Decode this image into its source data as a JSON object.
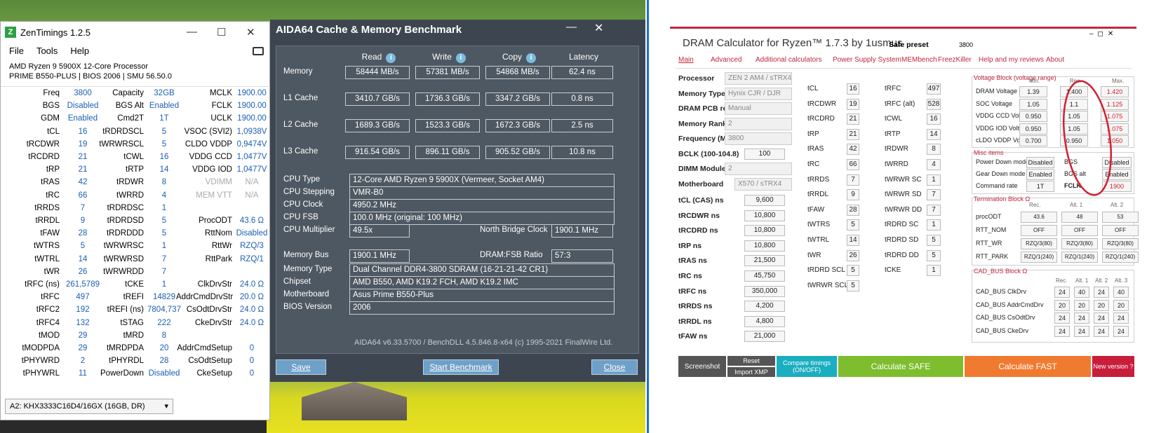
{
  "zentimings": {
    "title": "ZenTimings 1.2.5",
    "menu": [
      "File",
      "Tools",
      "Help"
    ],
    "cpu": "AMD Ryzen 9 5900X 12-Core Processor",
    "board": "PRIME B550-PLUS | BIOS 2006 | SMU 56.50.0",
    "rows": [
      [
        "Freq",
        "3800",
        "Capacity",
        "32GB",
        "MCLK",
        "1900.00"
      ],
      [
        "BGS",
        "Disabled",
        "BGS Alt",
        "Enabled",
        "FCLK",
        "1900.00"
      ],
      [
        "GDM",
        "Enabled",
        "Cmd2T",
        "1T",
        "UCLK",
        "1900.00"
      ],
      [
        "tCL",
        "16",
        "tRDRDSCL",
        "5",
        "VSOC (SVI2)",
        "1,0938V"
      ],
      [
        "tRCDWR",
        "19",
        "tWRWRSCL",
        "5",
        "CLDO VDDP",
        "0,9474V"
      ],
      [
        "tRCDRD",
        "21",
        "tCWL",
        "16",
        "VDDG CCD",
        "1,0477V"
      ],
      [
        "tRP",
        "21",
        "tRTP",
        "14",
        "VDDG IOD",
        "1,0477V"
      ],
      [
        "tRAS",
        "42",
        "tRDWR",
        "8",
        "VDIMM",
        "N/A"
      ],
      [
        "tRC",
        "66",
        "tWRRD",
        "4",
        "MEM VTT",
        "N/A"
      ],
      [
        "tRRDS",
        "7",
        "tRDRDSC",
        "1",
        "",
        ""
      ],
      [
        "tRRDL",
        "9",
        "tRDRDSD",
        "5",
        "ProcODT",
        "43.6 Ω"
      ],
      [
        "tFAW",
        "28",
        "tRDRDDD",
        "5",
        "RttNom",
        "Disabled"
      ],
      [
        "tWTRS",
        "5",
        "tWRWRSC",
        "1",
        "RttWr",
        "RZQ/3"
      ],
      [
        "tWTRL",
        "14",
        "tWRWRSD",
        "7",
        "RttPark",
        "RZQ/1"
      ],
      [
        "tWR",
        "26",
        "tWRWRDD",
        "7",
        "",
        ""
      ],
      [
        "tRFC (ns)",
        "261,5789",
        "tCKE",
        "1",
        "ClkDrvStr",
        "24.0 Ω"
      ],
      [
        "tRFC",
        "497",
        "tREFI",
        "14829",
        "AddrCmdDrvStr",
        "20.0 Ω"
      ],
      [
        "tRFC2",
        "192",
        "tREFI (ns)",
        "7804,737",
        "CsOdtDrvStr",
        "24.0 Ω"
      ],
      [
        "tRFC4",
        "132",
        "tSTAG",
        "222",
        "CkeDrvStr",
        "24.0 Ω"
      ],
      [
        "tMOD",
        "29",
        "tMRD",
        "8",
        "",
        ""
      ],
      [
        "tMODPDA",
        "29",
        "tMRDPDA",
        "20",
        "AddrCmdSetup",
        "0"
      ],
      [
        "tPHYWRD",
        "2",
        "tPHYRDL",
        "28",
        "CsOdtSetup",
        "0"
      ],
      [
        "tPHYWRL",
        "11",
        "PowerDown",
        "Disabled",
        "CkeSetup",
        "0"
      ]
    ],
    "dimm": "A2: KHX3333C16D4/16GX (16GB, DR)"
  },
  "aida": {
    "title": "AIDA64 Cache & Memory Benchmark",
    "headers": [
      "Read",
      "Write",
      "Copy",
      "Latency"
    ],
    "bench": [
      {
        "label": "Memory",
        "read": "58444 MB/s",
        "write": "57381 MB/s",
        "copy": "54868 MB/s",
        "lat": "62.4 ns"
      },
      {
        "label": "L1 Cache",
        "read": "3410.7 GB/s",
        "write": "1736.3 GB/s",
        "copy": "3347.2 GB/s",
        "lat": "0.8 ns"
      },
      {
        "label": "L2 Cache",
        "read": "1689.3 GB/s",
        "write": "1523.3 GB/s",
        "copy": "1672.3 GB/s",
        "lat": "2.5 ns"
      },
      {
        "label": "L3 Cache",
        "read": "916.54 GB/s",
        "write": "896.11 GB/s",
        "copy": "905.52 GB/s",
        "lat": "10.8 ns"
      }
    ],
    "cpu_type_label": "CPU Type",
    "cpu_type": "12-Core AMD Ryzen 9 5900X  (Vermeer, Socket AM4)",
    "cpu_step_label": "CPU Stepping",
    "cpu_step": "VMR-B0",
    "cpu_clock_label": "CPU Clock",
    "cpu_clock": "4950.2 MHz",
    "cpu_fsb_label": "CPU FSB",
    "cpu_fsb": "100.0 MHz  (original: 100 MHz)",
    "cpu_mult_label": "CPU Multiplier",
    "cpu_mult": "49.5x",
    "nb_label": "North Bridge Clock",
    "nb": "1900.1 MHz",
    "membus_label": "Memory Bus",
    "membus": "1900.1 MHz",
    "ratio_label": "DRAM:FSB Ratio",
    "ratio": "57:3",
    "memtype_label": "Memory Type",
    "memtype": "Dual Channel DDR4-3800 SDRAM  (16-21-21-42 CR1)",
    "chipset_label": "Chipset",
    "chipset": "AMD B550, AMD K19.2 FCH, AMD K19.2 IMC",
    "mb_label": "Motherboard",
    "mb": "Asus Prime B550-Plus",
    "bios_label": "BIOS Version",
    "bios": "2006",
    "footer": "AIDA64 v6.33.5700 / BenchDLL 4.5.846.8-x64  (c) 1995-2021 FinalWire Ltd.",
    "save": "Save",
    "start": "Start Benchmark",
    "close": "Close"
  },
  "dram": {
    "title": "DRAM Calculator for Ryzen™ 1.7.3 by 1usmus",
    "safe_label": "Safe preset",
    "safe_val": "3800",
    "tabs": [
      "Main",
      "Advanced",
      "Additional calculators",
      "Power Supply System",
      "MEMbench",
      "FreezKiller",
      "Help and my reviews",
      "About"
    ],
    "left": [
      [
        "Processor",
        "ZEN 2 AM4 / sTRX4"
      ],
      [
        "Memory Type",
        "Hynix CJR / DJR"
      ],
      [
        "DRAM PCB revision",
        "Manual"
      ],
      [
        "Memory Rank",
        "2"
      ],
      [
        "Frequency (MT/s)",
        "3800"
      ],
      [
        "BCLK (100-104.8)",
        "100"
      ],
      [
        "DIMM Modules",
        "2"
      ],
      [
        "Motherboard",
        "X570 / sTRX4"
      ],
      [
        "tCL (CAS) ns",
        "9,600"
      ],
      [
        "tRCDWR ns",
        "10,800"
      ],
      [
        "tRCDRD ns",
        "10,800"
      ],
      [
        "tRP ns",
        "10,800"
      ],
      [
        "tRAS ns",
        "21,500"
      ],
      [
        "tRC ns",
        "45,750"
      ],
      [
        "tRFC ns",
        "350,000"
      ],
      [
        "tRRDS ns",
        "4,200"
      ],
      [
        "tRRDL ns",
        "4,800"
      ],
      [
        "tFAW ns",
        "21,000"
      ]
    ],
    "col2": [
      [
        "tCL",
        "16"
      ],
      [
        "tRCDWR",
        "19"
      ],
      [
        "tRCDRD",
        "21"
      ],
      [
        "tRP",
        "21"
      ],
      [
        "tRAS",
        "42"
      ],
      [
        "tRC",
        "66"
      ],
      [
        "tRRDS",
        "7"
      ],
      [
        "tRRDL",
        "9"
      ],
      [
        "tFAW",
        "28"
      ],
      [
        "tWTRS",
        "5"
      ],
      [
        "tWTRL",
        "14"
      ],
      [
        "tWR",
        "26"
      ],
      [
        "tRDRD SCL",
        "5"
      ],
      [
        "tWRWR SCL",
        "5"
      ]
    ],
    "col3": [
      [
        "tRFC",
        "497"
      ],
      [
        "tRFC (alt)",
        "528"
      ],
      [
        "tCWL",
        "16"
      ],
      [
        "tRTP",
        "14"
      ],
      [
        "tRDWR",
        "8"
      ],
      [
        "tWRRD",
        "4"
      ],
      [
        "tWRWR SC",
        "1"
      ],
      [
        "tWRWR SD",
        "7"
      ],
      [
        "tWRWR DD",
        "7"
      ],
      [
        "tRDRD SC",
        "1"
      ],
      [
        "tRDRD SD",
        "5"
      ],
      [
        "tRDRD DD",
        "5"
      ],
      [
        "tCKE",
        "1"
      ]
    ],
    "vblock_title": "Voltage Block (voltage range)",
    "vhdr": [
      "Min.",
      "Rec.",
      "Max."
    ],
    "volts": [
      [
        "DRAM Voltage",
        "1.39",
        "1.400",
        "1.420"
      ],
      [
        "SOC Voltage",
        "1.05",
        "1.1",
        "1.125"
      ],
      [
        "VDDG  CCD Voltage",
        "0.950",
        "1.05",
        "1.075"
      ],
      [
        "VDDG  IOD Voltage",
        "0.950",
        "1.05",
        "1.075"
      ],
      [
        "cLDO VDDP Voltage",
        "0.700",
        "0.950",
        "1.050"
      ]
    ],
    "misc_title": "Misc items",
    "misc": [
      [
        "Power Down mode",
        "Disabled",
        "BGS",
        "Disabled"
      ],
      [
        "Gear Down mode",
        "Enabled",
        "BGS alt",
        "Enabled"
      ],
      [
        "Command rate",
        "1T",
        "FCLK",
        "1900"
      ]
    ],
    "term_title": "Termination Block Ω",
    "term_hdr": [
      "Rec.",
      "Alt. 1",
      "Alt. 2"
    ],
    "term": [
      [
        "procODT",
        "43.6",
        "48",
        "53"
      ],
      [
        "RTT_NOM",
        "OFF",
        "OFF",
        "OFF"
      ],
      [
        "RTT_WR",
        "RZQ/3(80)",
        "RZQ/3(80)",
        "RZQ/3(80)"
      ],
      [
        "RTT_PARK",
        "RZQ/1(240)",
        "RZQ/1(240)",
        "RZQ/1(240)"
      ]
    ],
    "cad_title": "CAD_BUS Block Ω",
    "cad_hdr": [
      "Rec.",
      "Alt. 1",
      "Alt. 2",
      "Alt. 3"
    ],
    "cad": [
      [
        "CAD_BUS ClkDrv",
        "24",
        "40",
        "24",
        "40"
      ],
      [
        "CAD_BUS AddrCmdDrv",
        "20",
        "20",
        "20",
        "20"
      ],
      [
        "CAD_BUS CsOdtDrv",
        "24",
        "24",
        "24",
        "24"
      ],
      [
        "CAD_BUS CkeDrv",
        "24",
        "24",
        "24",
        "24"
      ]
    ],
    "btn_screenshot": "Screenshot",
    "btn_reset": "Reset",
    "btn_import": "Import XMP",
    "btn_compare": "Compare timings (ON/OFF)",
    "btn_safe": "Calculate SAFE",
    "btn_fast": "Calculate FAST",
    "btn_new": "New version ?"
  }
}
